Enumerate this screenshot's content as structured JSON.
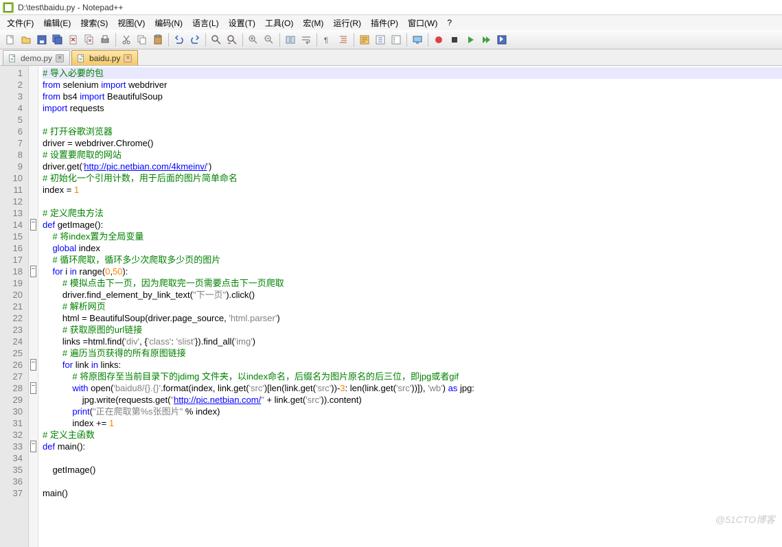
{
  "title": "D:\\test\\baidu.py - Notepad++",
  "menu": {
    "items": [
      "文件(F)",
      "编辑(E)",
      "搜索(S)",
      "视图(V)",
      "编码(N)",
      "语言(L)",
      "设置(T)",
      "工具(O)",
      "宏(M)",
      "运行(R)",
      "插件(P)",
      "窗口(W)"
    ],
    "help": "?"
  },
  "tabs": [
    {
      "label": "demo.py",
      "active": false
    },
    {
      "label": "baidu.py",
      "active": true
    }
  ],
  "code": {
    "lines": [
      {
        "n": 1,
        "seg": [
          {
            "t": "# 导入必要的包",
            "c": "cmt"
          }
        ],
        "cursor": true
      },
      {
        "n": 2,
        "seg": [
          {
            "t": "from",
            "c": "kw"
          },
          {
            "t": " selenium ",
            "c": "txt"
          },
          {
            "t": "import",
            "c": "kw"
          },
          {
            "t": " webdriver",
            "c": "txt"
          }
        ]
      },
      {
        "n": 3,
        "seg": [
          {
            "t": "from",
            "c": "kw"
          },
          {
            "t": " bs4 ",
            "c": "txt"
          },
          {
            "t": "import",
            "c": "kw"
          },
          {
            "t": " BeautifulSoup",
            "c": "txt"
          }
        ]
      },
      {
        "n": 4,
        "seg": [
          {
            "t": "import",
            "c": "kw"
          },
          {
            "t": " requests",
            "c": "txt"
          }
        ]
      },
      {
        "n": 5,
        "seg": []
      },
      {
        "n": 6,
        "seg": [
          {
            "t": "# 打开谷歌浏览器",
            "c": "cmt"
          }
        ]
      },
      {
        "n": 7,
        "seg": [
          {
            "t": "driver = webdriver.Chrome()",
            "c": "txt"
          }
        ]
      },
      {
        "n": 8,
        "seg": [
          {
            "t": "# 设置要爬取的网站",
            "c": "cmt"
          }
        ]
      },
      {
        "n": 9,
        "seg": [
          {
            "t": "driver.get(",
            "c": "txt"
          },
          {
            "t": "'",
            "c": "str"
          },
          {
            "t": "http://pic.netbian.com/4kmeinv/",
            "c": "url"
          },
          {
            "t": "'",
            "c": "str"
          },
          {
            "t": ")",
            "c": "txt"
          }
        ]
      },
      {
        "n": 10,
        "seg": [
          {
            "t": "# 初始化一个引用计数，用于后面的图片简单命名",
            "c": "cmt"
          }
        ]
      },
      {
        "n": 11,
        "seg": [
          {
            "t": "index = ",
            "c": "txt"
          },
          {
            "t": "1",
            "c": "num"
          }
        ]
      },
      {
        "n": 12,
        "seg": []
      },
      {
        "n": 13,
        "seg": [
          {
            "t": "# 定义爬虫方法",
            "c": "cmt"
          }
        ]
      },
      {
        "n": 14,
        "seg": [
          {
            "t": "def",
            "c": "kw"
          },
          {
            "t": " ",
            "c": "txt"
          },
          {
            "t": "getImage",
            "c": "fn"
          },
          {
            "t": "():",
            "c": "txt"
          }
        ],
        "fold": true
      },
      {
        "n": 15,
        "seg": [
          {
            "t": "    ",
            "c": "txt"
          },
          {
            "t": "# 将index置为全局变量",
            "c": "cmt"
          }
        ]
      },
      {
        "n": 16,
        "seg": [
          {
            "t": "    ",
            "c": "txt"
          },
          {
            "t": "global",
            "c": "kw"
          },
          {
            "t": " index",
            "c": "txt"
          }
        ]
      },
      {
        "n": 17,
        "seg": [
          {
            "t": "    ",
            "c": "txt"
          },
          {
            "t": "# 循环爬取，循环多少次爬取多少页的图片",
            "c": "cmt"
          }
        ]
      },
      {
        "n": 18,
        "seg": [
          {
            "t": "    ",
            "c": "txt"
          },
          {
            "t": "for",
            "c": "kw"
          },
          {
            "t": " i ",
            "c": "txt"
          },
          {
            "t": "in",
            "c": "kw"
          },
          {
            "t": " range(",
            "c": "txt"
          },
          {
            "t": "0",
            "c": "num"
          },
          {
            "t": ",",
            "c": "txt"
          },
          {
            "t": "50",
            "c": "num"
          },
          {
            "t": "):",
            "c": "txt"
          }
        ],
        "fold": true
      },
      {
        "n": 19,
        "seg": [
          {
            "t": "        ",
            "c": "txt"
          },
          {
            "t": "# 模拟点击下一页，因为爬取完一页需要点击下一页爬取",
            "c": "cmt"
          }
        ]
      },
      {
        "n": 20,
        "seg": [
          {
            "t": "        driver.find_element_by_link_text(",
            "c": "txt"
          },
          {
            "t": "\"下一页\"",
            "c": "str"
          },
          {
            "t": ").click()",
            "c": "txt"
          }
        ]
      },
      {
        "n": 21,
        "seg": [
          {
            "t": "        ",
            "c": "txt"
          },
          {
            "t": "# 解析网页",
            "c": "cmt"
          }
        ]
      },
      {
        "n": 22,
        "seg": [
          {
            "t": "        html = BeautifulSoup(driver.page_source, ",
            "c": "txt"
          },
          {
            "t": "'html.parser'",
            "c": "str"
          },
          {
            "t": ")",
            "c": "txt"
          }
        ]
      },
      {
        "n": 23,
        "seg": [
          {
            "t": "        ",
            "c": "txt"
          },
          {
            "t": "# 获取原图的url链接",
            "c": "cmt"
          }
        ]
      },
      {
        "n": 24,
        "seg": [
          {
            "t": "        links =html.find(",
            "c": "txt"
          },
          {
            "t": "'div'",
            "c": "str"
          },
          {
            "t": ", {",
            "c": "txt"
          },
          {
            "t": "'class'",
            "c": "str"
          },
          {
            "t": ": ",
            "c": "txt"
          },
          {
            "t": "'slist'",
            "c": "str"
          },
          {
            "t": "}).find_all(",
            "c": "txt"
          },
          {
            "t": "'img'",
            "c": "str"
          },
          {
            "t": ")",
            "c": "txt"
          }
        ]
      },
      {
        "n": 25,
        "seg": [
          {
            "t": "        ",
            "c": "txt"
          },
          {
            "t": "# 遍历当页获得的所有原图链接",
            "c": "cmt"
          }
        ]
      },
      {
        "n": 26,
        "seg": [
          {
            "t": "        ",
            "c": "txt"
          },
          {
            "t": "for",
            "c": "kw"
          },
          {
            "t": " link ",
            "c": "txt"
          },
          {
            "t": "in",
            "c": "kw"
          },
          {
            "t": " links:",
            "c": "txt"
          }
        ],
        "fold": true
      },
      {
        "n": 27,
        "seg": [
          {
            "t": "            ",
            "c": "txt"
          },
          {
            "t": "# 将原图存至当前目录下的jdimg 文件夹，以index命名，后缀名为图片原名的后三位，即jpg或者gif",
            "c": "cmt"
          }
        ]
      },
      {
        "n": 28,
        "seg": [
          {
            "t": "            ",
            "c": "txt"
          },
          {
            "t": "with",
            "c": "kw"
          },
          {
            "t": " open(",
            "c": "txt"
          },
          {
            "t": "'baidu8/{}.{}'",
            "c": "str"
          },
          {
            "t": ".format(index, link.get(",
            "c": "txt"
          },
          {
            "t": "'src'",
            "c": "str"
          },
          {
            "t": ")[len(link.get(",
            "c": "txt"
          },
          {
            "t": "'src'",
            "c": "str"
          },
          {
            "t": "))-",
            "c": "txt"
          },
          {
            "t": "3",
            "c": "num"
          },
          {
            "t": ": len(link.get(",
            "c": "txt"
          },
          {
            "t": "'src'",
            "c": "str"
          },
          {
            "t": "))]), ",
            "c": "txt"
          },
          {
            "t": "'wb'",
            "c": "str"
          },
          {
            "t": ") ",
            "c": "txt"
          },
          {
            "t": "as",
            "c": "kw"
          },
          {
            "t": " jpg:",
            "c": "txt"
          }
        ],
        "fold": true
      },
      {
        "n": 29,
        "seg": [
          {
            "t": "                jpg.write(requests.get(",
            "c": "txt"
          },
          {
            "t": "\"",
            "c": "str"
          },
          {
            "t": "http://pic.netbian.com/",
            "c": "url"
          },
          {
            "t": "\"",
            "c": "str"
          },
          {
            "t": " + link.get(",
            "c": "txt"
          },
          {
            "t": "'src'",
            "c": "str"
          },
          {
            "t": ")).content)",
            "c": "txt"
          }
        ]
      },
      {
        "n": 30,
        "seg": [
          {
            "t": "            ",
            "c": "txt"
          },
          {
            "t": "print",
            "c": "kw"
          },
          {
            "t": "(",
            "c": "txt"
          },
          {
            "t": "\"正在爬取第%s张图片\"",
            "c": "str"
          },
          {
            "t": " % index)",
            "c": "txt"
          }
        ]
      },
      {
        "n": 31,
        "seg": [
          {
            "t": "            index += ",
            "c": "txt"
          },
          {
            "t": "1",
            "c": "num"
          }
        ]
      },
      {
        "n": 32,
        "seg": [
          {
            "t": "# 定义主函数",
            "c": "cmt"
          }
        ]
      },
      {
        "n": 33,
        "seg": [
          {
            "t": "def",
            "c": "kw"
          },
          {
            "t": " ",
            "c": "txt"
          },
          {
            "t": "main",
            "c": "fn"
          },
          {
            "t": "():",
            "c": "txt"
          }
        ],
        "fold": true
      },
      {
        "n": 34,
        "seg": []
      },
      {
        "n": 35,
        "seg": [
          {
            "t": "    getImage()",
            "c": "txt"
          }
        ]
      },
      {
        "n": 36,
        "seg": []
      },
      {
        "n": 37,
        "seg": [
          {
            "t": "main()",
            "c": "txt"
          }
        ]
      }
    ]
  },
  "watermark": "@51CTO博客"
}
